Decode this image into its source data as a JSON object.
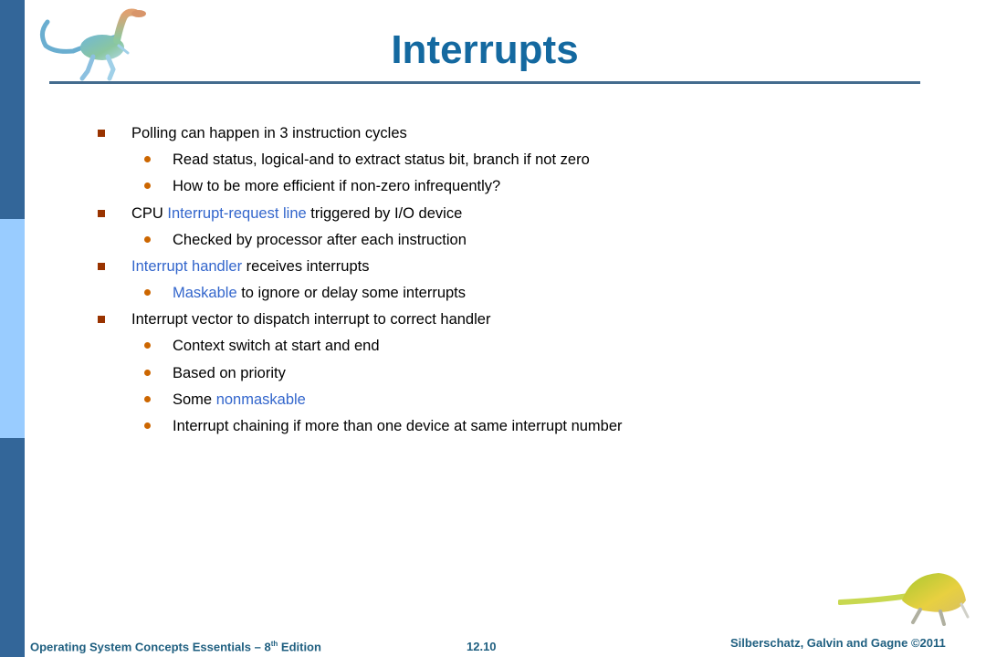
{
  "slide": {
    "title": "Interrupts",
    "bullets": [
      {
        "parts": [
          {
            "text": "Polling can happen in 3 instruction cycles",
            "highlight": false
          }
        ],
        "sub": [
          [
            {
              "text": "Read status, logical-and to extract status bit, branch if not zero",
              "highlight": false
            }
          ],
          [
            {
              "text": "How to be more efficient if non-zero infrequently?",
              "highlight": false
            }
          ]
        ]
      },
      {
        "parts": [
          {
            "text": "CPU ",
            "highlight": false
          },
          {
            "text": "Interrupt-request line",
            "highlight": true
          },
          {
            "text": " triggered by I/O device",
            "highlight": false
          }
        ],
        "sub": [
          [
            {
              "text": "Checked by processor after each instruction",
              "highlight": false
            }
          ]
        ]
      },
      {
        "parts": [
          {
            "text": "Interrupt handler",
            "highlight": true
          },
          {
            "text": " receives interrupts",
            "highlight": false
          }
        ],
        "sub": [
          [
            {
              "text": "Maskable",
              "highlight": true
            },
            {
              "text": " to ignore or delay some interrupts",
              "highlight": false
            }
          ]
        ]
      },
      {
        "parts": [
          {
            "text": "Interrupt vector to dispatch interrupt to correct handler",
            "highlight": false
          }
        ],
        "sub": [
          [
            {
              "text": "Context switch at start and end",
              "highlight": false
            }
          ],
          [
            {
              "text": "Based on priority",
              "highlight": false
            }
          ],
          [
            {
              "text": "Some ",
              "highlight": false
            },
            {
              "text": "nonmaskable",
              "highlight": true
            }
          ],
          [
            {
              "text": "Interrupt chaining if more than one device at same interrupt number",
              "highlight": false
            }
          ]
        ]
      }
    ]
  },
  "footer": {
    "book_title_prefix": "Operating System Concepts Essentials – 8",
    "book_title_sup": "th",
    "book_title_suffix": " Edition",
    "page_number": "12.10",
    "copyright": "Silberschatz, Galvin and Gagne ©2011"
  },
  "colors": {
    "title": "#1469a0",
    "highlight": "#3366cc",
    "bullet_level1": "#993300",
    "bullet_level2": "#cc6600",
    "sidebar_dark": "#336699",
    "sidebar_light": "#99ccff",
    "footer": "#1f5f80"
  },
  "icons": {
    "top_logo": "dinosaur-logo-icon",
    "bottom_logo": "dinosaur-logo-icon"
  }
}
